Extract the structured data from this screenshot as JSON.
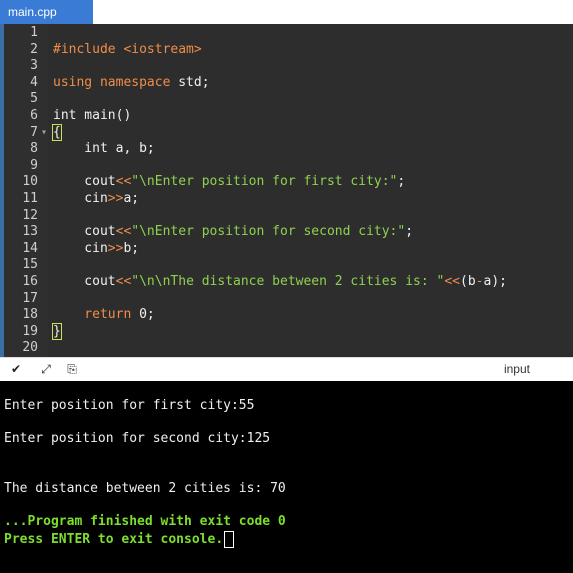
{
  "tab": {
    "filename": "main.cpp"
  },
  "editor": {
    "lines": [
      {
        "n": "1"
      },
      {
        "n": "2",
        "tokens": [
          {
            "t": "#include <iostream>",
            "c": "kw"
          }
        ]
      },
      {
        "n": "3"
      },
      {
        "n": "4",
        "tokens": [
          {
            "t": "using namespace ",
            "c": "kw"
          },
          {
            "t": "std;",
            "c": "ty"
          }
        ]
      },
      {
        "n": "5"
      },
      {
        "n": "6",
        "tokens": [
          {
            "t": "int main()",
            "c": "ty"
          }
        ]
      },
      {
        "n": "7",
        "fold": true,
        "tokens": [
          {
            "t": "{",
            "c": "brace"
          }
        ]
      },
      {
        "n": "8",
        "tokens": [
          {
            "t": "    int a, b;",
            "c": "ty"
          }
        ]
      },
      {
        "n": "9"
      },
      {
        "n": "10",
        "tokens": [
          {
            "t": "    cout",
            "c": "ty"
          },
          {
            "t": "<<",
            "c": "op"
          },
          {
            "t": "\"\\nEnter position for first city:\"",
            "c": "str"
          },
          {
            "t": ";",
            "c": "ty"
          }
        ]
      },
      {
        "n": "11",
        "tokens": [
          {
            "t": "    cin",
            "c": "ty"
          },
          {
            "t": ">>",
            "c": "op"
          },
          {
            "t": "a;",
            "c": "ty"
          }
        ]
      },
      {
        "n": "12"
      },
      {
        "n": "13",
        "tokens": [
          {
            "t": "    cout",
            "c": "ty"
          },
          {
            "t": "<<",
            "c": "op"
          },
          {
            "t": "\"\\nEnter position for second city:\"",
            "c": "str"
          },
          {
            "t": ";",
            "c": "ty"
          }
        ]
      },
      {
        "n": "14",
        "tokens": [
          {
            "t": "    cin",
            "c": "ty"
          },
          {
            "t": ">>",
            "c": "op"
          },
          {
            "t": "b;",
            "c": "ty"
          }
        ]
      },
      {
        "n": "15"
      },
      {
        "n": "16",
        "tokens": [
          {
            "t": "    cout",
            "c": "ty"
          },
          {
            "t": "<<",
            "c": "op"
          },
          {
            "t": "\"\\n\\nThe distance between 2 cities is: \"",
            "c": "str"
          },
          {
            "t": "<<",
            "c": "op"
          },
          {
            "t": "(b",
            "c": "ty"
          },
          {
            "t": "-",
            "c": "op"
          },
          {
            "t": "a);",
            "c": "ty"
          }
        ]
      },
      {
        "n": "17"
      },
      {
        "n": "18",
        "tokens": [
          {
            "t": "    return ",
            "c": "kw"
          },
          {
            "t": "0",
            "c": "num"
          },
          {
            "t": ";",
            "c": "ty"
          }
        ]
      },
      {
        "n": "19",
        "tokens": [
          {
            "t": "}",
            "c": "brace"
          }
        ],
        "cursor": true
      },
      {
        "n": "20"
      }
    ]
  },
  "toolbar": {
    "collapse_icon": "chevron-down-icon",
    "expand_icon": "expand-icon",
    "copy_icon": "copy-icon",
    "input_label": "input"
  },
  "console": {
    "lines": [
      {
        "text": "Enter position for first city:55",
        "style": "normal"
      },
      {
        "text": "Enter position for second city:125",
        "style": "normal"
      },
      {
        "text": "The distance between 2 cities is: 70",
        "style": "normal"
      },
      {
        "text": "...Program finished with exit code 0",
        "style": "green"
      },
      {
        "text": "Press ENTER to exit console.",
        "style": "green",
        "cursor": true
      }
    ]
  },
  "colors": {
    "accent": "#3a7bd5",
    "keyword": "#f08d49",
    "string": "#8fd14f",
    "console_green": "#7cdf2c"
  }
}
